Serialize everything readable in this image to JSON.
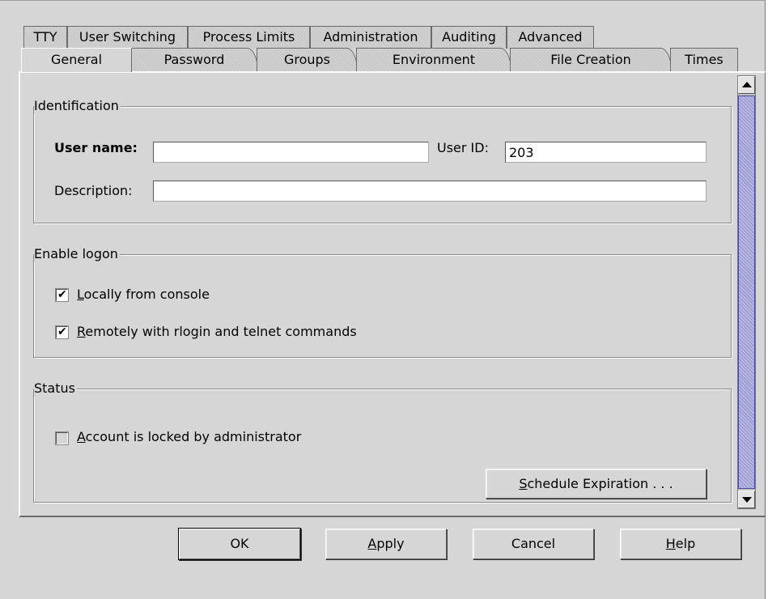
{
  "tabs_row1": [
    {
      "label": "TTY"
    },
    {
      "label": "User Switching"
    },
    {
      "label": "Process Limits"
    },
    {
      "label": "Administration"
    },
    {
      "label": "Auditing"
    },
    {
      "label": "Advanced"
    }
  ],
  "tabs_row2": [
    {
      "label": "General",
      "active": true
    },
    {
      "label": "Password"
    },
    {
      "label": "Groups"
    },
    {
      "label": "Environment"
    },
    {
      "label": "File Creation"
    },
    {
      "label": "Times"
    }
  ],
  "identification": {
    "title": "Identification",
    "username_label": "User name:",
    "username_value": "",
    "userid_label": "User ID:",
    "userid_value": "203",
    "description_label": "Description:",
    "description_value": ""
  },
  "enable_logon": {
    "title": "Enable logon",
    "local": {
      "label_first": "L",
      "label_rest": "ocally from console",
      "checked": true
    },
    "remote": {
      "label_first": "R",
      "label_rest": "emotely with rlogin and telnet commands",
      "checked": true
    }
  },
  "status": {
    "title": "Status",
    "locked": {
      "label_first": "A",
      "label_rest": "ccount is locked by administrator",
      "checked": false
    },
    "schedule_first": "S",
    "schedule_rest": "chedule Expiration . . ."
  },
  "scrollbar": {
    "position_fraction": 0.0
  },
  "buttons": {
    "ok": "OK",
    "apply_first": "A",
    "apply_rest": "pply",
    "cancel": "Cancel",
    "help_first": "H",
    "help_rest": "elp"
  },
  "check_glyph": "✔"
}
